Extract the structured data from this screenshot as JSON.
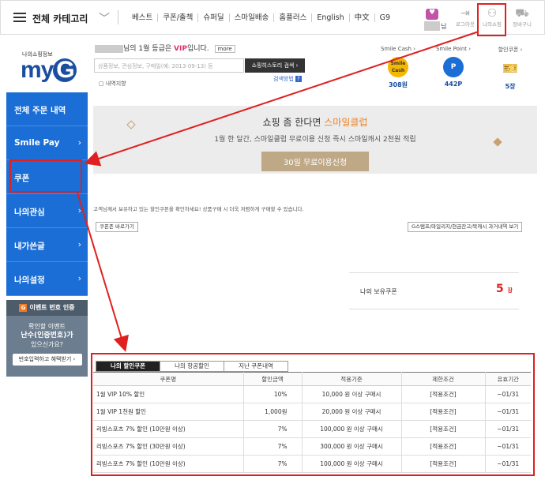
{
  "header": {
    "category_title": "전체 카테고리",
    "nav": [
      "베스트",
      "쿠폰/출첵",
      "슈퍼딜",
      "스마일배송",
      "홈플러스",
      "English",
      "中文",
      "G9"
    ],
    "user_suffix": "님",
    "icons": [
      {
        "name": "login-icon",
        "glyph": "⇥",
        "label": "로그아웃"
      },
      {
        "name": "my-shopping-icon",
        "glyph": "👤",
        "label": "나의쇼핑"
      },
      {
        "name": "cart-icon",
        "glyph": "🛒",
        "label": "장바구니"
      }
    ]
  },
  "myg": {
    "logo_sub": "나의쇼핑정보",
    "logo_text": "my",
    "logo_g": "G",
    "grade_pre": "님의 1월 등급은",
    "grade_level": "VIP",
    "grade_post": "입니다.",
    "more": "more",
    "search_placeholder": "상품정보, 관심정보, 구매일(예: 2013-09-13) 등",
    "search_button": "쇼핑히스토리 검색 ›",
    "search_help": "검색방법",
    "history_toggle": "내역지향"
  },
  "stats": [
    {
      "label": "Smile Cash ›",
      "icon": "Smile Cash",
      "value": "308원",
      "color": "#f5b800"
    },
    {
      "label": "Smile Point ›",
      "icon": "P",
      "value": "442P",
      "color": "#1a6ed6"
    },
    {
      "label": "할인쿠폰 ›",
      "icon": "coupon",
      "value": "5장",
      "color": "#1a6ed6"
    }
  ],
  "sidebar": {
    "items": [
      {
        "label": "전체 주문 내역",
        "arrow": ""
      },
      {
        "label": "Smile Pay",
        "arrow": "›"
      },
      {
        "label": "쿠폰",
        "arrow": ""
      },
      {
        "label": "나의관심",
        "arrow": "›"
      },
      {
        "label": "내가쓴글",
        "arrow": "›"
      },
      {
        "label": "나의설정",
        "arrow": "›"
      }
    ]
  },
  "event": {
    "badge": "G",
    "title": "이벤트 번호 인증",
    "line1": "확인할 이벤트",
    "line2": "난수(인증번호)가",
    "line3": "있으신가요?",
    "button": "번호입력하고 혜택받기 ›"
  },
  "banner": {
    "title_pre": "쇼핑 좀 한다면",
    "title_highlight": "스마일클럽",
    "subtitle": "1월 한 달간, 스마일클럽 무료이용 신청 즉시 스마일캐시 2천원 적립",
    "button": "30일 무료이용신청"
  },
  "coupon_page": {
    "notice": "고객님께서 보유하고 있는 할인쿠폰을 확인하세요! 상품구매 시 더욱 저렴하게 구매할 수 있습니다.",
    "shortcut_button": "쿠폰존 바로가기",
    "history_button": "G스탬프/마일리지/현금잔고/북캐시 과거내역 보기",
    "holding_label": "나의 보유쿠폰",
    "holding_count": "5",
    "holding_unit": "장",
    "tabs": [
      "나의 할인쿠폰",
      "나의 항공할인",
      "지난 쿠폰내역"
    ],
    "columns": [
      "쿠폰명",
      "할인금액",
      "적용기준",
      "제한조건",
      "유효기간"
    ],
    "rows": [
      {
        "name": "1월 VIP 10% 할인",
        "amount": "10%",
        "basis": "10,000 원 이상 구매시",
        "limit": "[적용조건]",
        "period": "~01/31"
      },
      {
        "name": "1월 VIP 1천원 할인",
        "amount": "1,000원",
        "basis": "20,000 원 이상 구매시",
        "limit": "[적용조건]",
        "period": "~01/31"
      },
      {
        "name": "리빙스포츠 7% 할인 (10만원 이상)",
        "amount": "7%",
        "basis": "100,000 원 이상 구매시",
        "limit": "[적용조건]",
        "period": "~01/31"
      },
      {
        "name": "리빙스포츠 7% 할인 (30만원 이상)",
        "amount": "7%",
        "basis": "300,000 원 이상 구매시",
        "limit": "[적용조건]",
        "period": "~01/31"
      },
      {
        "name": "리빙스포츠 7% 할인 (10만원 이상)",
        "amount": "7%",
        "basis": "100,000 원 이상 구매시",
        "limit": "[적용조건]",
        "period": "~01/31"
      }
    ]
  },
  "colors": {
    "brand_blue": "#1a6ed6",
    "highlight_red": "#e02020",
    "vip_pink": "#e03070"
  }
}
